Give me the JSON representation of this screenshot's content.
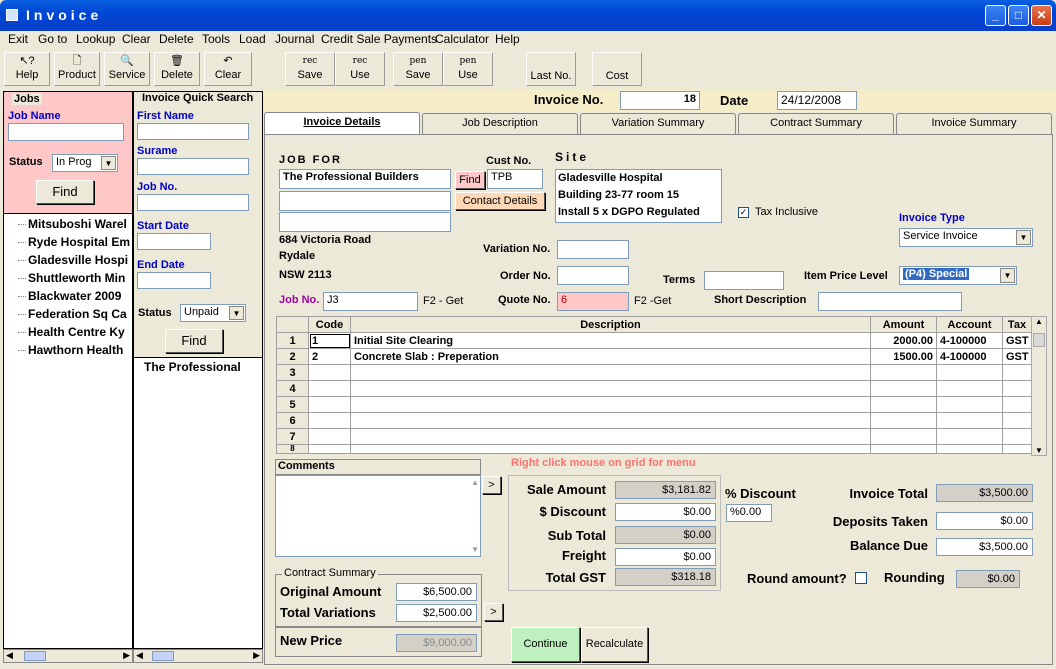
{
  "window": {
    "title": "Invoice",
    "min": "_",
    "max": "□",
    "close": "✕"
  },
  "menu": [
    "Exit",
    "Go to",
    "Lookup",
    "Clear",
    "Delete",
    "Tools",
    "Load",
    "Journal",
    "Credit Sale Payments",
    "Calculator",
    "Help"
  ],
  "toolbar": {
    "help": "Help",
    "product": "Product",
    "service": "Service",
    "delete": "Delete",
    "clear": "Clear",
    "rec_save_top": "rec",
    "rec_save": "Save",
    "rec_use_top": "rec",
    "rec_use": "Use",
    "pen_save_top": "pen",
    "pen_save": "Save",
    "pen_use_top": "pen",
    "pen_use": "Use",
    "last_no": "Last No.",
    "cost": "Cost"
  },
  "jobs": {
    "title": "Jobs",
    "job_name_label": "Job Name",
    "status_label": "Status",
    "status_value": "In Prog",
    "find": "Find",
    "items": [
      "Mitsuboshi Warel",
      "Ryde Hospital Em",
      "Gladesville Hospi",
      "Shuttleworth Min",
      "Blackwater 2009",
      "Federation Sq Ca",
      "Health Centre Ky",
      "Hawthorn Health"
    ]
  },
  "quick": {
    "title": "Invoice Quick Search",
    "first_name": "First Name",
    "surname": "Surame",
    "job_no": "Job No.",
    "start_date": "Start Date",
    "end_date": "End Date",
    "status_label": "Status",
    "status_value": "Unpaid",
    "find": "Find",
    "result": "The Professional"
  },
  "header": {
    "invoice_no_label": "Invoice No.",
    "invoice_no": "18",
    "date_label": "Date",
    "date": "24/12/2008"
  },
  "tabs": [
    "Invoice Details",
    "Job Description",
    "Variation Summary",
    "Contract Summary",
    "Invoice Summary"
  ],
  "details": {
    "job_for_label": "JOB FOR",
    "job_for": "The Professional Builders",
    "find": "Find",
    "cust_no_label": "Cust No.",
    "cust_no": "TPB",
    "contact_details": "Contact Details",
    "site_label": "Site",
    "site_lines": [
      "Gladesville Hospital",
      "Building 23-77 room 15",
      "Install 5 x DGPO Regulated"
    ],
    "address1": "684 Victoria Road",
    "address2": "Rydale",
    "address3": "NSW  2113",
    "tax_inclusive": "Tax Inclusive",
    "invoice_type_label": "Invoice Type",
    "invoice_type": "Service Invoice",
    "variation_no_label": "Variation No.",
    "order_no_label": "Order No.",
    "terms_label": "Terms",
    "item_price_level_label": "Item Price Level",
    "item_price_level": "(P4) Special",
    "job_no_label": "Job No.",
    "job_no": "J3",
    "f2_get": "F2 - Get",
    "quote_no_label": "Quote No.",
    "quote_no": "6",
    "f2_get2": "F2 -Get",
    "short_desc_label": "Short Description"
  },
  "grid": {
    "headers": [
      "Code",
      "Description",
      "Amount",
      "Account",
      "Tax"
    ],
    "rows": [
      {
        "n": "1",
        "code": "1",
        "desc": "Initial Site Clearing",
        "amount": "2000.00",
        "account": "4-100000",
        "tax": "GST"
      },
      {
        "n": "2",
        "code": "2",
        "desc": "Concrete Slab : Preperation",
        "amount": "1500.00",
        "account": "4-100000",
        "tax": "GST"
      },
      {
        "n": "3",
        "code": "",
        "desc": "",
        "amount": "",
        "account": "",
        "tax": ""
      },
      {
        "n": "4",
        "code": "",
        "desc": "",
        "amount": "",
        "account": "",
        "tax": ""
      },
      {
        "n": "5",
        "code": "",
        "desc": "",
        "amount": "",
        "account": "",
        "tax": ""
      },
      {
        "n": "6",
        "code": "",
        "desc": "",
        "amount": "",
        "account": "",
        "tax": ""
      },
      {
        "n": "7",
        "code": "",
        "desc": "",
        "amount": "",
        "account": "",
        "tax": ""
      },
      {
        "n": "8",
        "code": "",
        "desc": "",
        "amount": "",
        "account": "",
        "tax": ""
      }
    ]
  },
  "comments_label": "Comments",
  "grid_hint": "Right click mouse on grid for menu",
  "totals": {
    "sale_amount_label": "Sale Amount",
    "sale_amount": "$3,181.82",
    "discount_label": "$ Discount",
    "discount": "$0.00",
    "pct_discount_label": "% Discount",
    "pct_discount": "%0.00",
    "sub_total_label": "Sub Total",
    "sub_total": "$0.00",
    "freight_label": "Freight",
    "freight": "$0.00",
    "total_gst_label": "Total GST",
    "total_gst": "$318.18",
    "invoice_total_label": "Invoice Total",
    "invoice_total": "$3,500.00",
    "deposits_label": "Deposits Taken",
    "deposits": "$0.00",
    "balance_label": "Balance Due",
    "balance": "$3,500.00",
    "round_label": "Round amount?",
    "rounding_label": "Rounding",
    "rounding": "$0.00"
  },
  "contract": {
    "title": "Contract Summary",
    "original_label": "Original Amount",
    "original": "$6,500.00",
    "variations_label": "Total Variations",
    "variations": "$2,500.00",
    "new_price_label": "New Price",
    "new_price": "$9,000.00"
  },
  "actions": {
    "continue": "Continue",
    "recalculate": "Recalculate",
    "arrow": ">"
  }
}
